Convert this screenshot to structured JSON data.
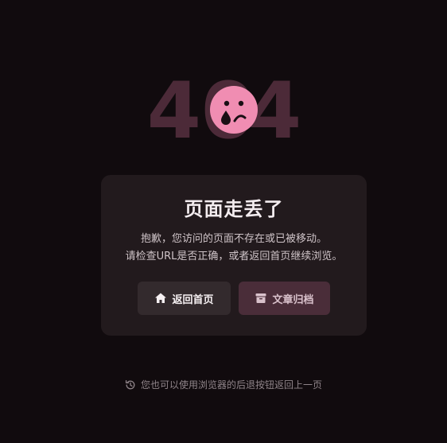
{
  "error": {
    "code_digits": [
      "4",
      "0",
      "4"
    ]
  },
  "card": {
    "title": "页面走丢了",
    "description_line1": "抱歉，您访问的页面不存在或已被移动。",
    "description_line2": "请检查URL是否正确，或者返回首页继续浏览。"
  },
  "buttons": {
    "home_label": "返回首页",
    "home_icon": "home-icon",
    "archive_label": "文章归档",
    "archive_icon": "archive-icon"
  },
  "hint": {
    "text": "您也可以使用浏览器的后退按钮返回上一页",
    "icon": "history-icon"
  },
  "colors": {
    "background": "#110b0e",
    "digits": "#4c2a38",
    "face": "#f08db2",
    "card": "#221a1d",
    "home_button": "#332a2d",
    "archive_button": "#4a2d39"
  }
}
